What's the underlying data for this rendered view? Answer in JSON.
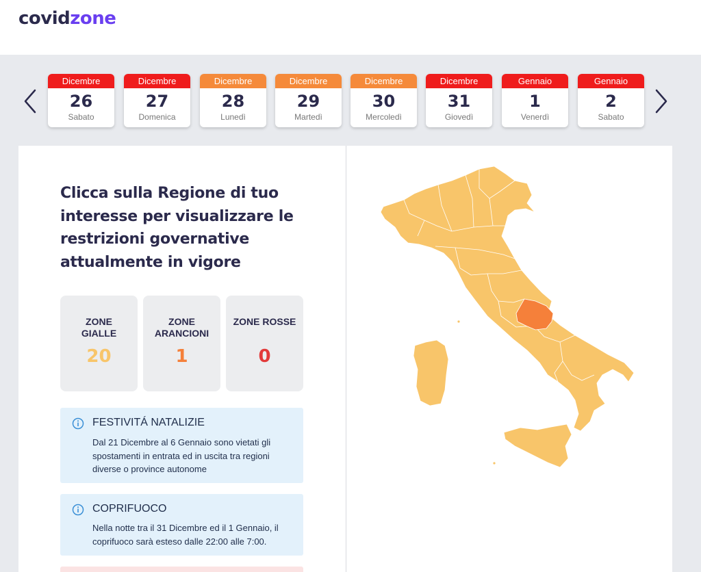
{
  "brand": {
    "part1": "covid",
    "part2": "zone"
  },
  "nav": {
    "prev_icon": "chevron-left-icon",
    "next_icon": "chevron-right-icon"
  },
  "days": [
    {
      "month": "Dicembre",
      "day": "26",
      "weekday": "Sabato",
      "color": "#ef1c1c"
    },
    {
      "month": "Dicembre",
      "day": "27",
      "weekday": "Domenica",
      "color": "#ef1c1c"
    },
    {
      "month": "Dicembre",
      "day": "28",
      "weekday": "Lunedì",
      "color": "#f58a3a"
    },
    {
      "month": "Dicembre",
      "day": "29",
      "weekday": "Martedì",
      "color": "#f58a3a"
    },
    {
      "month": "Dicembre",
      "day": "30",
      "weekday": "Mercoledì",
      "color": "#f58a3a"
    },
    {
      "month": "Dicembre",
      "day": "31",
      "weekday": "Giovedì",
      "color": "#ef1c1c"
    },
    {
      "month": "Gennaio",
      "day": "1",
      "weekday": "Venerdì",
      "color": "#ef1c1c"
    },
    {
      "month": "Gennaio",
      "day": "2",
      "weekday": "Sabato",
      "color": "#ef1c1c"
    }
  ],
  "headline": "Clicca sulla Regione di tuo interesse per visualizzare le restrizioni governative attualmente in vigore",
  "stats": [
    {
      "label_line1": "ZONE",
      "label_line2": "GIALLE",
      "value": "20",
      "color": "#f8c56a"
    },
    {
      "label_line1": "ZONE",
      "label_line2": "ARANCIONI",
      "value": "1",
      "color": "#f5803a"
    },
    {
      "label_line1": "ZONE ROSSE",
      "label_line2": "",
      "value": "0",
      "color": "#e23a3a"
    }
  ],
  "notices": [
    {
      "title": "FESTIVITÁ NATALIZIE",
      "body": "Dal 21 Dicembre al 6 Gennaio sono vietati gli spostamenti in entrata ed in uscita tra regioni diverse o province autonome",
      "icon": "info-icon"
    },
    {
      "title": "COPRIFUOCO",
      "body": "Nella notte tra il 31 Dicembre ed il 1 Gennaio, il coprifuoco sarà esteso dalle 22:00 alle 7:00.",
      "icon": "info-icon"
    }
  ],
  "map": {
    "yellow": "#f8c56a",
    "orange": "#f5803a",
    "highlighted_region": "Abruzzo"
  }
}
